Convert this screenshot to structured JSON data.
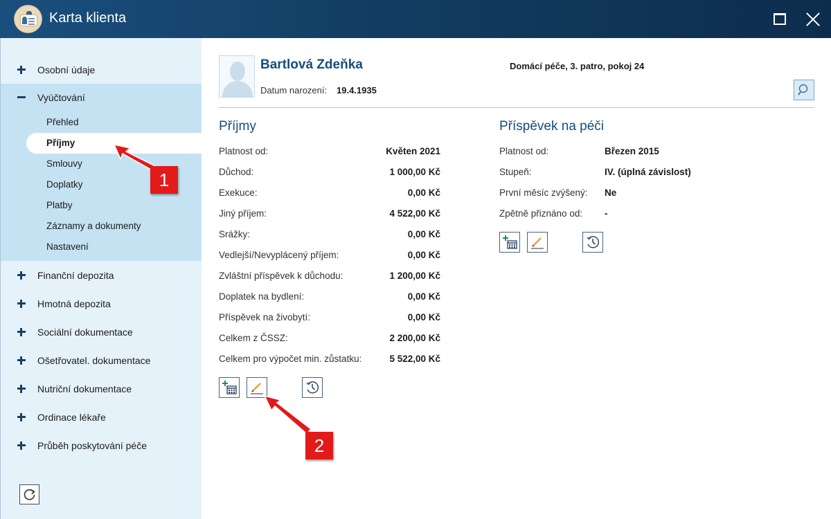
{
  "window": {
    "title": "Karta klienta"
  },
  "sidebar": {
    "items": [
      {
        "label": "Osobní údaje"
      },
      {
        "label": "Vyúčtování"
      },
      {
        "label": "Finanční depozita"
      },
      {
        "label": "Hmotná depozita"
      },
      {
        "label": "Sociální dokumentace"
      },
      {
        "label": "Ošetřovatel. dokumentace"
      },
      {
        "label": "Nutriční dokumentace"
      },
      {
        "label": "Ordinace lékaře"
      },
      {
        "label": "Průběh poskytování péče"
      }
    ],
    "subitems": [
      {
        "label": "Přehled"
      },
      {
        "label": "Příjmy"
      },
      {
        "label": "Smlouvy"
      },
      {
        "label": "Doplatky"
      },
      {
        "label": "Platby"
      },
      {
        "label": "Záznamy a dokumenty"
      },
      {
        "label": "Nastavení"
      }
    ]
  },
  "client": {
    "name": "Bartlová Zdeňka",
    "dob_label": "Datum narození:",
    "dob": "19.4.1935",
    "location": "Domácí péče, 3. patro, pokoj 24"
  },
  "income": {
    "title": "Příjmy",
    "rows": [
      {
        "label": "Platnost od:",
        "value": "Květen 2021"
      },
      {
        "label": "Důchod:",
        "value": "1 000,00 Kč"
      },
      {
        "label": "Exekuce:",
        "value": "0,00 Kč"
      },
      {
        "label": "Jiný příjem:",
        "value": "4 522,00 Kč"
      },
      {
        "label": "Srážky:",
        "value": "0,00 Kč"
      },
      {
        "label": "Vedlejší/Nevyplácený příjem:",
        "value": "0,00 Kč"
      },
      {
        "label": "Zvláštní příspěvek k důchodu:",
        "value": "1 200,00 Kč"
      },
      {
        "label": "Doplatek na bydlení:",
        "value": "0,00 Kč"
      },
      {
        "label": "Příspěvek na živobytí:",
        "value": "0,00 Kč"
      },
      {
        "label": "Celkem z ČSSZ:",
        "value": "2 200,00 Kč"
      },
      {
        "label": "Celkem pro výpočet min. zůstatku:",
        "value": "5 522,00 Kč"
      }
    ]
  },
  "care": {
    "title": "Příspěvek na péči",
    "rows": [
      {
        "label": "Platnost od:",
        "value": "Březen 2015"
      },
      {
        "label": "Stupeň:",
        "value": "IV. (úplná závislost)"
      },
      {
        "label": "První měsíc zvýšený:",
        "value": "Ne"
      },
      {
        "label": "Zpětně přiznáno od:",
        "value": "-"
      }
    ]
  },
  "annotations": {
    "one": "1",
    "two": "2"
  },
  "colors": {
    "titlebar": "#123d62",
    "accent": "#164c7c",
    "sidebar": "#e6f2fa",
    "sidebar_selected": "#c5e2f3",
    "annotation": "#e31a1a"
  }
}
